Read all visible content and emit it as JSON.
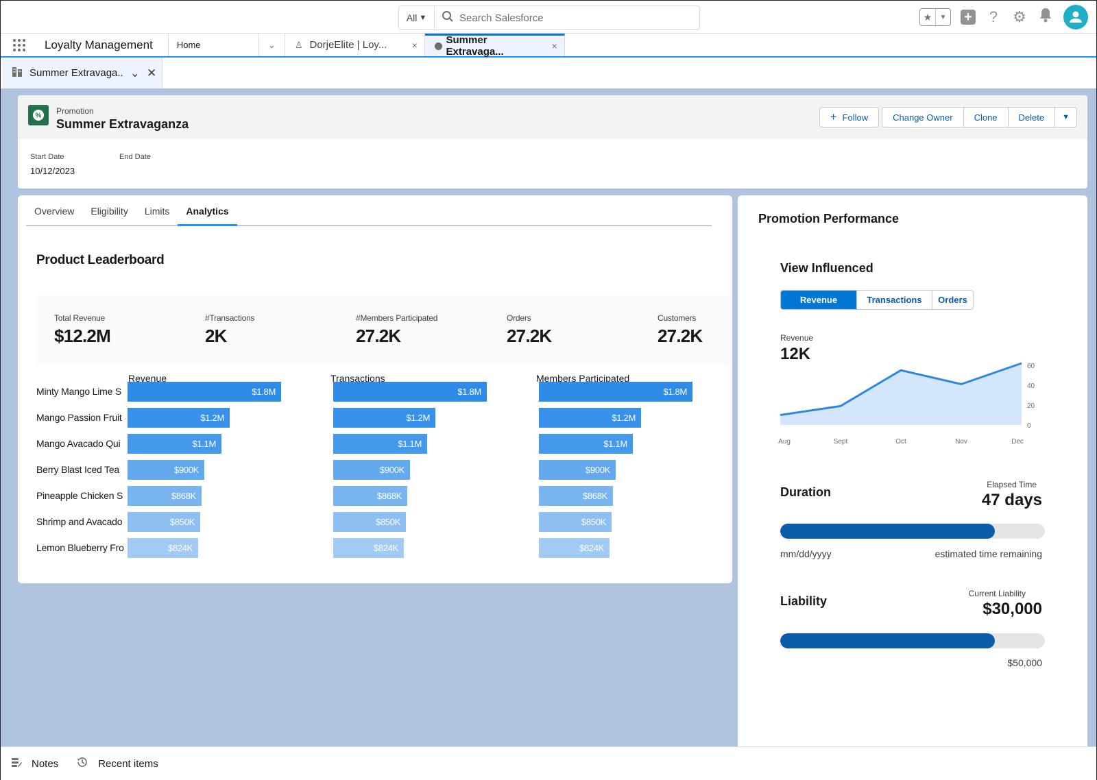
{
  "header": {
    "search_scope": "All",
    "search_placeholder": "Search Salesforce",
    "icons": [
      "favorites-icon",
      "favorites-dropdown-icon",
      "global-actions-icon",
      "help-icon",
      "setup-gear-icon",
      "notifications-bell-icon",
      "user-avatar-icon"
    ]
  },
  "nav": {
    "app_name": "Loyalty Management",
    "home_tab": "Home",
    "tabs": [
      {
        "label": "DorjeElite | Loy...",
        "icon": "loyalty-member-icon",
        "active": false
      },
      {
        "label": "Summer Extravaga...",
        "icon": "promotion-icon",
        "active": true
      }
    ]
  },
  "subtab": {
    "label": "Summer Extravaga.."
  },
  "record": {
    "type": "Promotion",
    "title": "Summer Extravaganza",
    "actions": {
      "follow": "Follow",
      "change_owner": "Change Owner",
      "clone": "Clone",
      "delete": "Delete"
    },
    "fields": [
      {
        "label": "Start Date",
        "value": "10/12/2023"
      },
      {
        "label": "End Date",
        "value": ""
      }
    ]
  },
  "tabs": [
    {
      "label": "Overview",
      "active": false
    },
    {
      "label": "Eligibility",
      "active": false
    },
    {
      "label": "Limits",
      "active": false
    },
    {
      "label": "Analytics",
      "active": true
    }
  ],
  "leaderboard": {
    "title": "Product Leaderboard",
    "kpis": [
      {
        "label": "Total Revenue",
        "value": "$12.2M"
      },
      {
        "label": "#Transactions",
        "value": "2K"
      },
      {
        "label": "#Members Participated",
        "value": "27.2K"
      },
      {
        "label": "Orders",
        "value": "27.2K"
      },
      {
        "label": "Customers",
        "value": "27.2K"
      }
    ]
  },
  "performance": {
    "title": "Promotion Performance",
    "view_influenced": {
      "title": "View Influenced",
      "options": [
        {
          "label": "Revenue",
          "active": true
        },
        {
          "label": "Transactions",
          "active": false
        },
        {
          "label": "Orders",
          "active": false
        }
      ],
      "metric_label": "Revenue",
      "metric_value": "12K"
    },
    "duration": {
      "title": "Duration",
      "small_label": "Elapsed Time",
      "value": "47 days",
      "progress_fraction": 0.81,
      "start_label": "mm/dd/yyyy",
      "end_label": "estimated time remaining"
    },
    "liability": {
      "title": "Liability",
      "small_label": "Current Liability",
      "value": "$30,000",
      "progress_fraction": 0.81,
      "max_label": "$50,000"
    }
  },
  "utility_bar": {
    "items": [
      {
        "label": "Notes",
        "icon": "notes-icon"
      },
      {
        "label": "Recent items",
        "icon": "history-icon"
      }
    ]
  },
  "colors": {
    "brand": "#0176d3",
    "progress": "#0b5cab",
    "bar_shades": [
      "#2e8be8",
      "#3790ea",
      "#4499eb",
      "#62a9ee",
      "#78b5f0",
      "#8ebff2",
      "#a2cbf4"
    ],
    "area_fill": "#d3e6fb",
    "line": "#2f86e0",
    "page_bg": "#b0c4df"
  },
  "chart_data": [
    {
      "type": "bar",
      "title": "Revenue",
      "orientation": "horizontal",
      "categories": [
        "Minty Mango Lime S",
        "Mango Passion Fruit",
        "Mango Avacado Qui",
        "Berry Blast Iced Tea",
        "Pineapple Chicken S",
        "Shrimp and Avacado",
        "Lemon Blueberry Fro"
      ],
      "values": [
        1800000,
        1200000,
        1100000,
        900000,
        868000,
        850000,
        824000
      ],
      "labels": [
        "$1.8M",
        "$1.2M",
        "$1.1M",
        "$900K",
        "$868K",
        "$850K",
        "$824K"
      ]
    },
    {
      "type": "bar",
      "title": "Transactions",
      "orientation": "horizontal",
      "categories": [
        "Minty Mango Lime S",
        "Mango Passion Fruit",
        "Mango Avacado Qui",
        "Berry Blast Iced Tea",
        "Pineapple Chicken S",
        "Shrimp and Avacado",
        "Lemon Blueberry Fro"
      ],
      "values": [
        1800000,
        1200000,
        1100000,
        900000,
        868000,
        850000,
        824000
      ],
      "labels": [
        "$1.8M",
        "$1.2M",
        "$1.1M",
        "$900K",
        "$868K",
        "$850K",
        "$824K"
      ]
    },
    {
      "type": "bar",
      "title": "Members Participated",
      "orientation": "horizontal",
      "categories": [
        "Minty Mango Lime S",
        "Mango Passion Fruit",
        "Mango Avacado Qui",
        "Berry Blast Iced Tea",
        "Pineapple Chicken S",
        "Shrimp and Avacado",
        "Lemon Blueberry Fro"
      ],
      "values": [
        1800000,
        1200000,
        1100000,
        900000,
        868000,
        850000,
        824000
      ],
      "labels": [
        "$1.8M",
        "$1.2M",
        "$1.1M",
        "$900K",
        "$868K",
        "$850K",
        "$824K"
      ]
    },
    {
      "type": "area",
      "title": "Revenue",
      "x": [
        "Aug",
        "Sept",
        "Oct",
        "Nov",
        "Dec"
      ],
      "values": [
        10,
        19,
        55,
        41,
        62
      ],
      "ylim": [
        0,
        62
      ],
      "yticks": [
        0,
        20,
        40,
        60
      ],
      "y_axis_side": "right",
      "grid": false
    }
  ]
}
